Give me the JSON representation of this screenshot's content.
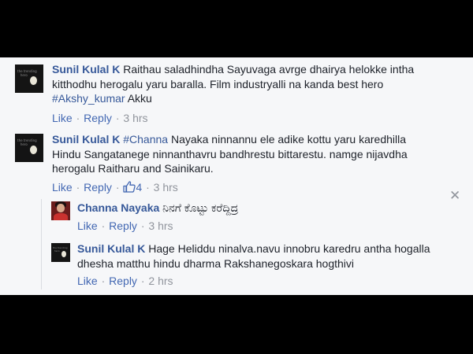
{
  "comments": [
    {
      "author": "Sunil Kulal K",
      "text": "Raithau saladhindha Sayuvaga avrge dhairya helokke intha kitthodhu herogalu yaru baralla. Film industryalli na kanda best hero",
      "hashtag": "#Akshy_kumar",
      "text_after": "Akku",
      "like": "Like",
      "reply": "Reply",
      "time": "3 hrs",
      "avatar_icon": "avatar-photo"
    },
    {
      "author": "Sunil Kulal K",
      "mention": "#Channa",
      "text": "Nayaka ninnannu ele adike kottu yaru karedhilla Hindu Sangatanege ninnanthavru bandhrestu bittarestu. namge nijavdha herogalu Raitharu and Sainikaru.",
      "like": "Like",
      "reply": "Reply",
      "reactions": "4",
      "time": "3 hrs",
      "close_icon": "close-icon"
    }
  ],
  "replies": [
    {
      "author": "Channa Nayaka",
      "text": "ನಿನಗೆ ಕೊಟ್ಟು ಕರೆದ್ದಿದ್ರ",
      "like": "Like",
      "reply": "Reply",
      "time": "3 hrs"
    },
    {
      "author": "Sunil Kulal K",
      "text": "Hage Heliddu ninalva.navu innobru karedru antha hogalla dhesha matthu hindu dharma Rakshanegoskara hogthivi",
      "like": "Like",
      "reply": "Reply",
      "time": "2 hrs"
    }
  ],
  "colors": {
    "link": "#365899",
    "action": "#4267b2",
    "meta": "#90949c",
    "background": "#f6f7f9"
  }
}
